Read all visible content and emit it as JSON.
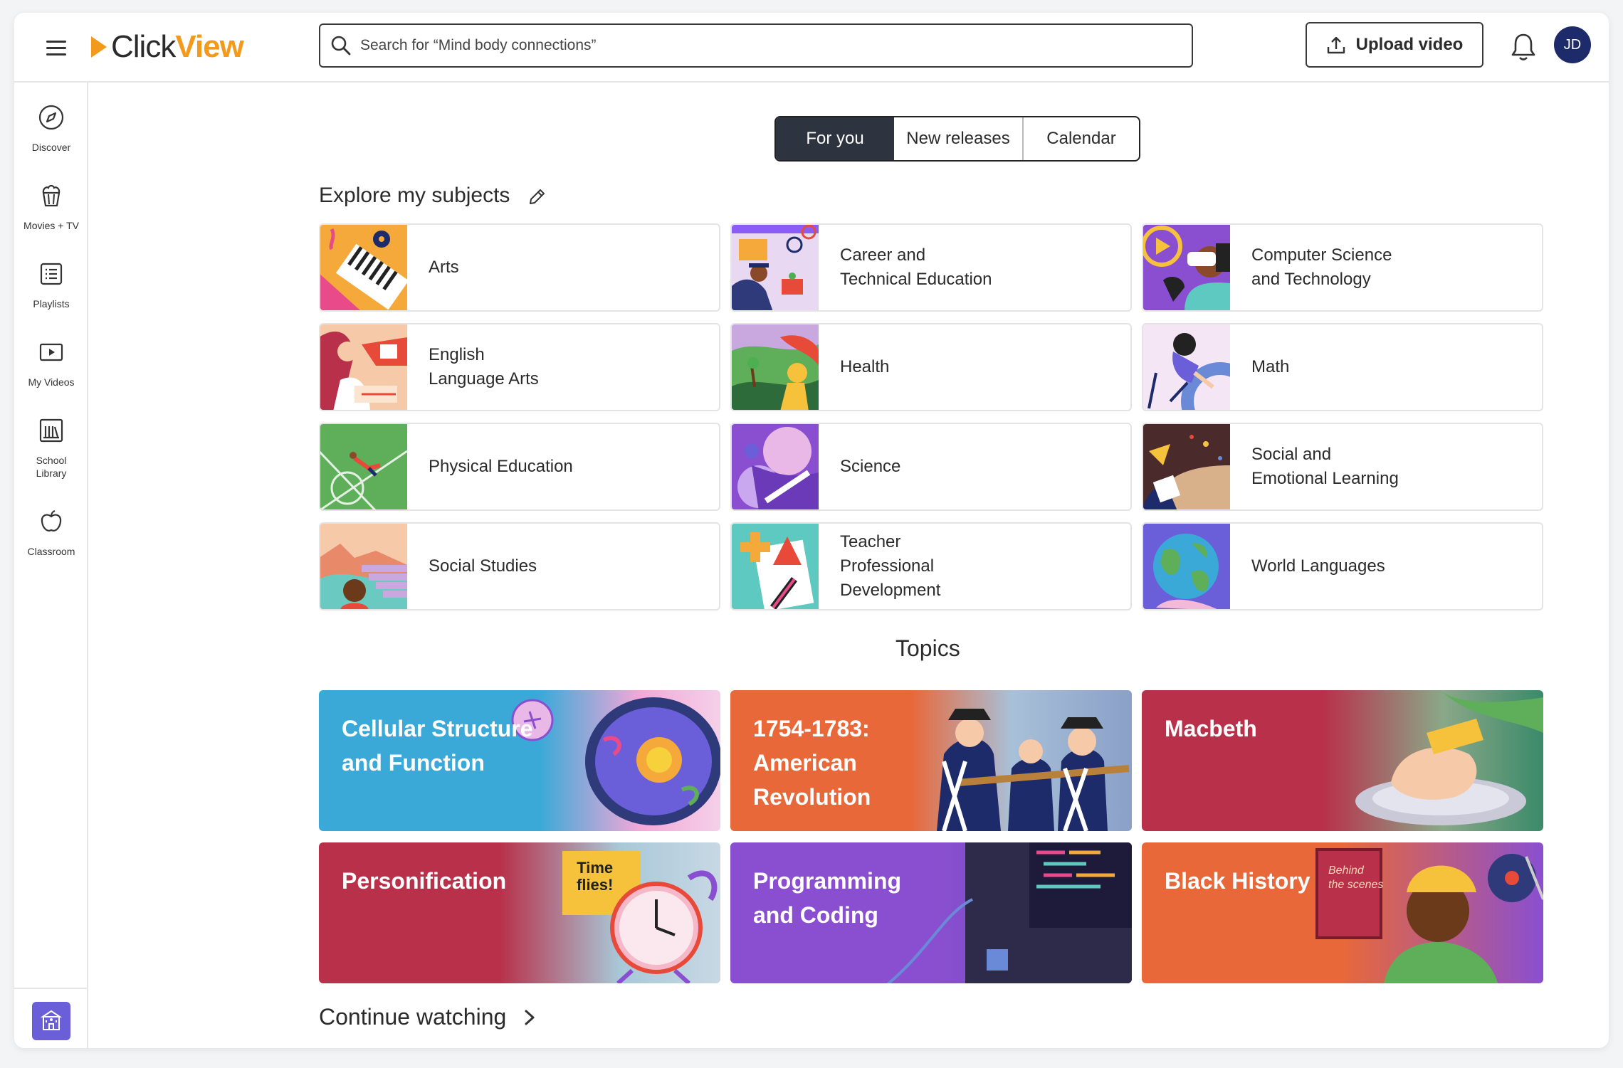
{
  "header": {
    "logo_click": "Click",
    "logo_view": "View",
    "search_placeholder": "Search for “Mind body connections”",
    "upload_label": "Upload video",
    "avatar_initials": "JD"
  },
  "sidebar": {
    "items": [
      {
        "label": "Discover",
        "icon": "compass-icon"
      },
      {
        "label": "Movies + TV",
        "icon": "popcorn-icon"
      },
      {
        "label": "Playlists",
        "icon": "list-icon"
      },
      {
        "label": "My Videos",
        "icon": "play-icon"
      },
      {
        "label": "School\nLibrary",
        "icon": "library-icon"
      },
      {
        "label": "Classroom",
        "icon": "apple-icon"
      }
    ],
    "bottom_icon": "school-icon"
  },
  "tabs": [
    "For you",
    "New releases",
    "Calendar"
  ],
  "explore_title": "Explore my subjects",
  "subjects": [
    {
      "label": "Arts"
    },
    {
      "label": "Career and\nTechnical Education"
    },
    {
      "label": "Computer Science\nand Technology"
    },
    {
      "label": "English\nLanguage Arts"
    },
    {
      "label": "Health"
    },
    {
      "label": "Math"
    },
    {
      "label": "Physical Education"
    },
    {
      "label": "Science"
    },
    {
      "label": "Social and\nEmotional Learning"
    },
    {
      "label": "Social Studies"
    },
    {
      "label": "Teacher\nProfessional\nDevelopment"
    },
    {
      "label": "World Languages"
    }
  ],
  "topics_title": "Topics",
  "topics": [
    {
      "label": "Cellular Structure\nand Function",
      "color": "#3aa9d8"
    },
    {
      "label": "1754-1783:\nAmerican\nRevolution",
      "color": "#e8683a"
    },
    {
      "label": "Macbeth",
      "color": "#b8304a"
    },
    {
      "label": "Personification",
      "color": "#b8304a"
    },
    {
      "label": "Programming\nand Coding",
      "color": "#8a4fd0"
    },
    {
      "label": "Black History",
      "color": "#e8683a"
    }
  ],
  "topic_art_text": {
    "time_flies": "Time\nflies!",
    "behind_the_scenes": "Behind\nthe scenes"
  },
  "continue_watching": "Continue watching",
  "colors": {
    "accent": "#f39a1d",
    "tab_active": "#2e3340",
    "avatar": "#1d2b6b",
    "school_button": "#6a5fd8"
  }
}
